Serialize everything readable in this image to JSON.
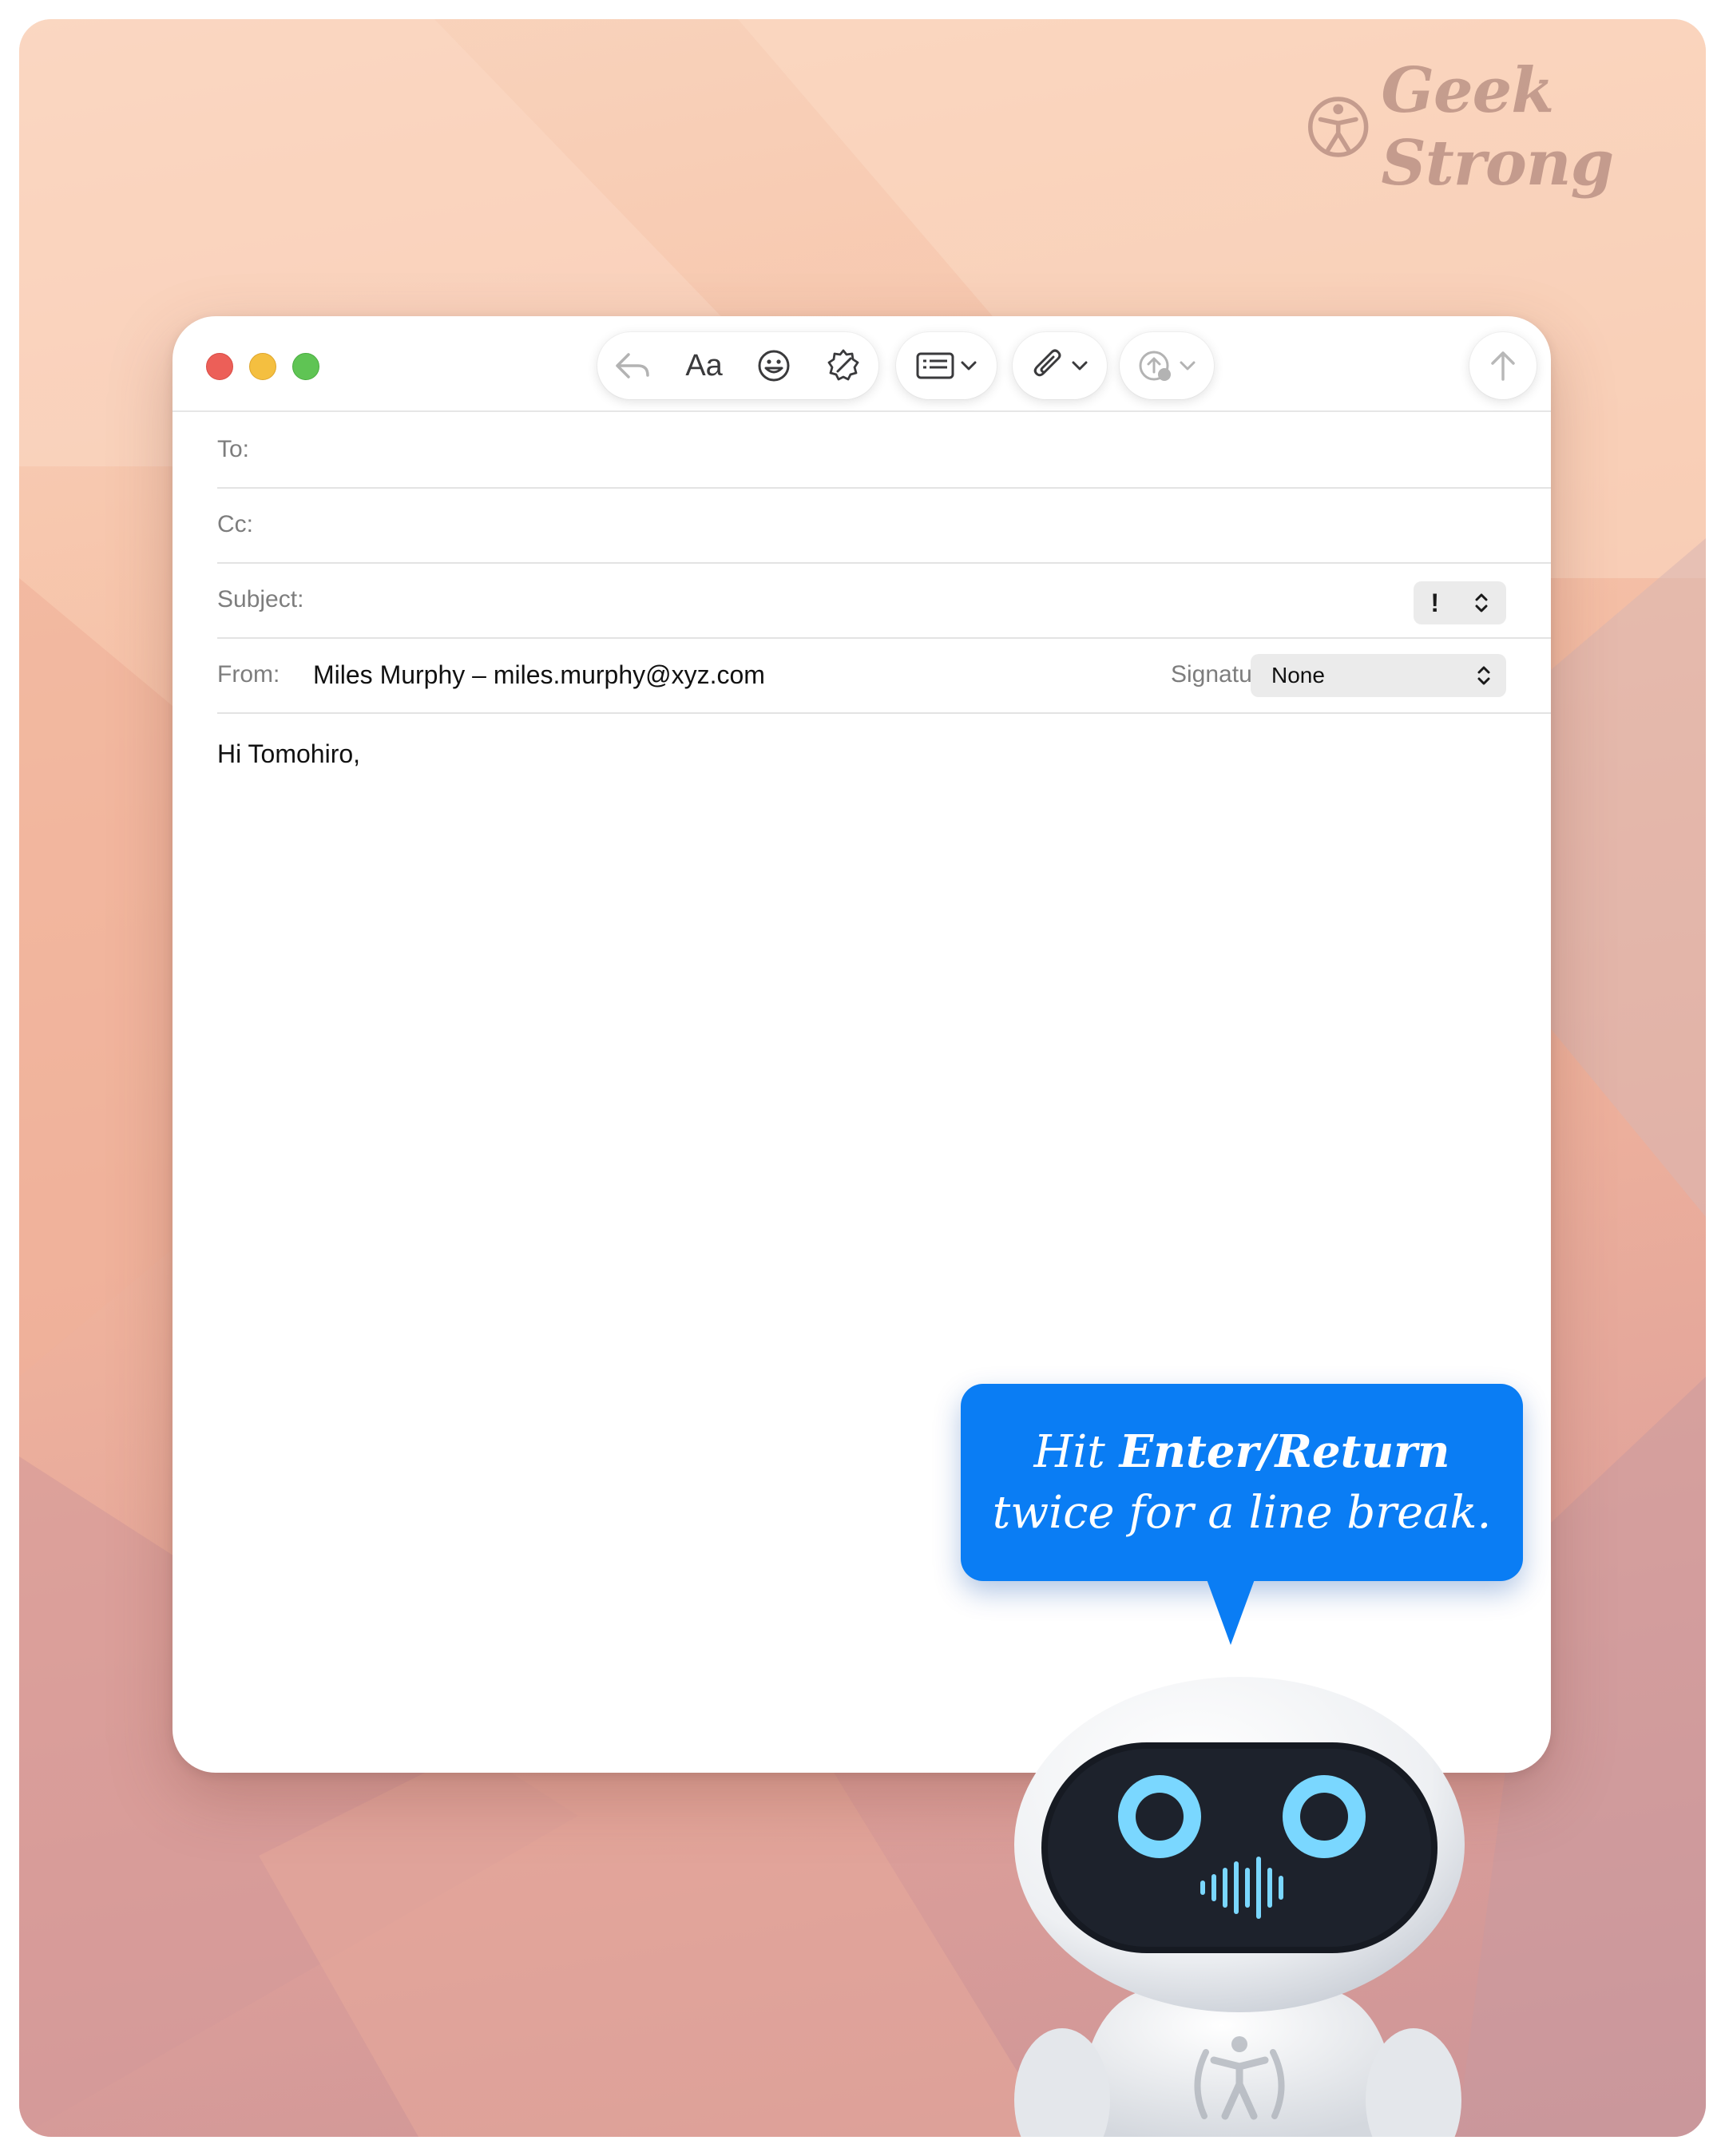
{
  "brand": {
    "name": "Geek Strong"
  },
  "window": {
    "traffic_lights": [
      "close",
      "minimize",
      "zoom"
    ],
    "toolbar": {
      "buttons": [
        "reply-icon",
        "Aa",
        "emoji-icon",
        "writing-tools-icon",
        "header-fields-icon",
        "attachment-icon",
        "photo-browser-icon",
        "send-icon"
      ],
      "font_label": "Aa"
    },
    "fields": {
      "to_label": "To:",
      "cc_label": "Cc:",
      "subject_label": "Subject:",
      "priority": "!",
      "from_label": "From:",
      "from_value": "Miles Murphy – miles.murphy@xyz.com",
      "signature_label": "Signature:",
      "signature_value": "None"
    },
    "body": "Hi Tomohiro,"
  },
  "tip": {
    "prefix": "Hit ",
    "strong": "Enter/Return",
    "line2": "twice for a line break."
  },
  "colors": {
    "accent_blue": "#0a7df4",
    "close": "#ec5f58",
    "minimize": "#f4bf40",
    "zoom": "#5fc454",
    "robot_eyes": "#7ad7ff"
  }
}
